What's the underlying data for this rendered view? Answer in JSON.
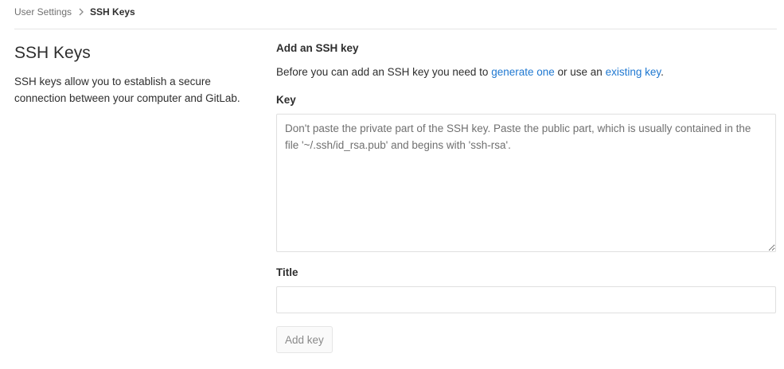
{
  "breadcrumb": {
    "parent": "User Settings",
    "current": "SSH Keys"
  },
  "sidebar": {
    "title": "SSH Keys",
    "description": "SSH keys allow you to establish a secure connection between your computer and GitLab."
  },
  "form": {
    "section_title": "Add an SSH key",
    "intro_before": "Before you can add an SSH key you need to ",
    "generate_link": "generate one",
    "intro_middle": " or use an ",
    "existing_link": "existing key",
    "intro_after": ".",
    "key_label": "Key",
    "key_placeholder": "Don't paste the private part of the SSH key. Paste the public part, which is usually contained in the file '~/.ssh/id_rsa.pub' and begins with 'ssh-rsa'.",
    "key_value": "",
    "title_label": "Title",
    "title_value": "",
    "submit_label": "Add key"
  },
  "colors": {
    "link": "#1f78d1",
    "text": "#2e2e2e",
    "muted": "#707070"
  },
  "icons": {
    "breadcrumb_separator": "chevron-right-icon"
  }
}
